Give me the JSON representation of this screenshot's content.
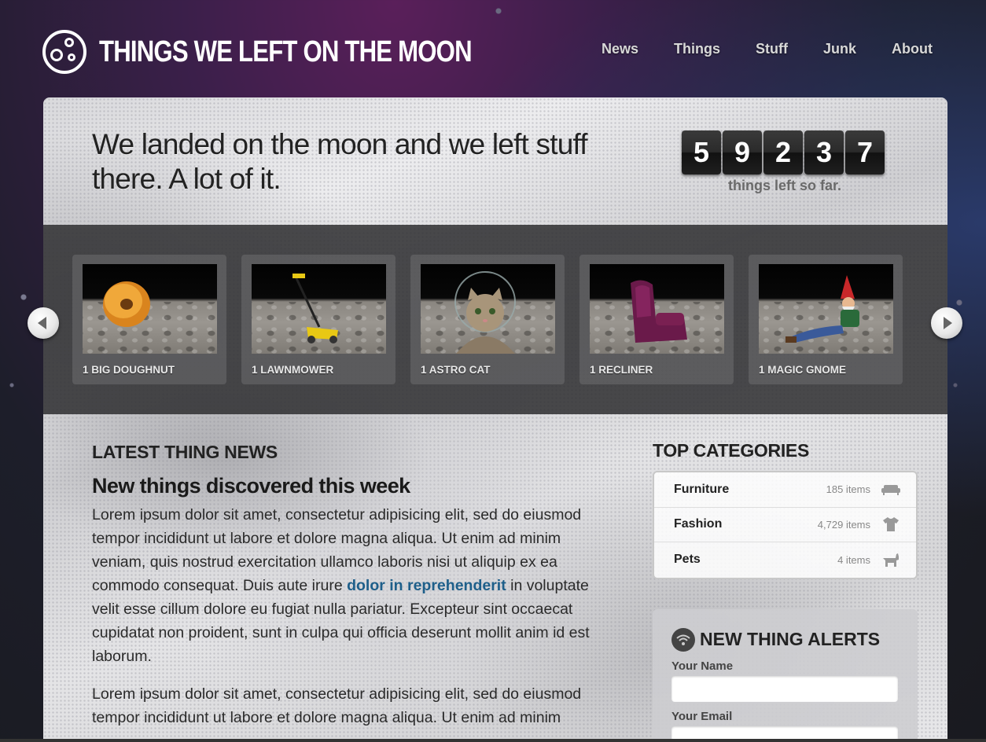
{
  "site": {
    "title": "THINGS WE LEFT ON THE MOON",
    "logo_icon": "moon-icon"
  },
  "nav": {
    "items": [
      {
        "label": "News"
      },
      {
        "label": "Things"
      },
      {
        "label": "Stuff"
      },
      {
        "label": "Junk"
      },
      {
        "label": "About"
      }
    ]
  },
  "hero": {
    "headline": "We landed on the moon and we left stuff there. A lot of it.",
    "counter_digits": [
      "5",
      "9",
      "2",
      "3",
      "7"
    ],
    "counter_label": "things left so far."
  },
  "carousel": {
    "prev_icon": "chevron-left-icon",
    "next_icon": "chevron-right-icon",
    "items": [
      {
        "label": "1 BIG DOUGHNUT"
      },
      {
        "label": "1 LAWNMOWER"
      },
      {
        "label": "1 ASTRO CAT"
      },
      {
        "label": "1 RECLINER"
      },
      {
        "label": "1 MAGIC GNOME"
      }
    ]
  },
  "news": {
    "heading": "LATEST THING NEWS",
    "title": "New things discovered this week",
    "para1_before": "Lorem ipsum dolor sit amet, consectetur adipisicing elit, sed do eiusmod tempor incididunt ut labore et dolore magna aliqua. Ut enim ad minim veniam, quis nostrud exercitation ullamco laboris nisi ut aliquip ex ea commodo consequat. Duis aute irure ",
    "para1_link": "dolor in reprehenderit",
    "para1_after": " in voluptate velit esse cillum dolore eu fugiat nulla pariatur. Excepteur sint occaecat cupidatat non proident, sunt in culpa qui officia deserunt mollit anim id est laborum.",
    "para2": "Lorem ipsum dolor sit amet, consectetur adipisicing elit, sed do eiusmod tempor incididunt ut labore et dolore magna aliqua. Ut enim ad minim"
  },
  "categories": {
    "heading": "TOP CATEGORIES",
    "items": [
      {
        "name": "Furniture",
        "count": "185 items",
        "icon": "sofa-icon"
      },
      {
        "name": "Fashion",
        "count": "4,729 items",
        "icon": "tshirt-icon"
      },
      {
        "name": "Pets",
        "count": "4 items",
        "icon": "pet-icon"
      }
    ]
  },
  "alerts": {
    "heading": "NEW THING ALERTS",
    "icon": "wifi-icon",
    "name_label": "Your Name",
    "email_label": "Your Email"
  },
  "colors": {
    "link": "#1e5f8a",
    "counter_bg": "#222222"
  }
}
